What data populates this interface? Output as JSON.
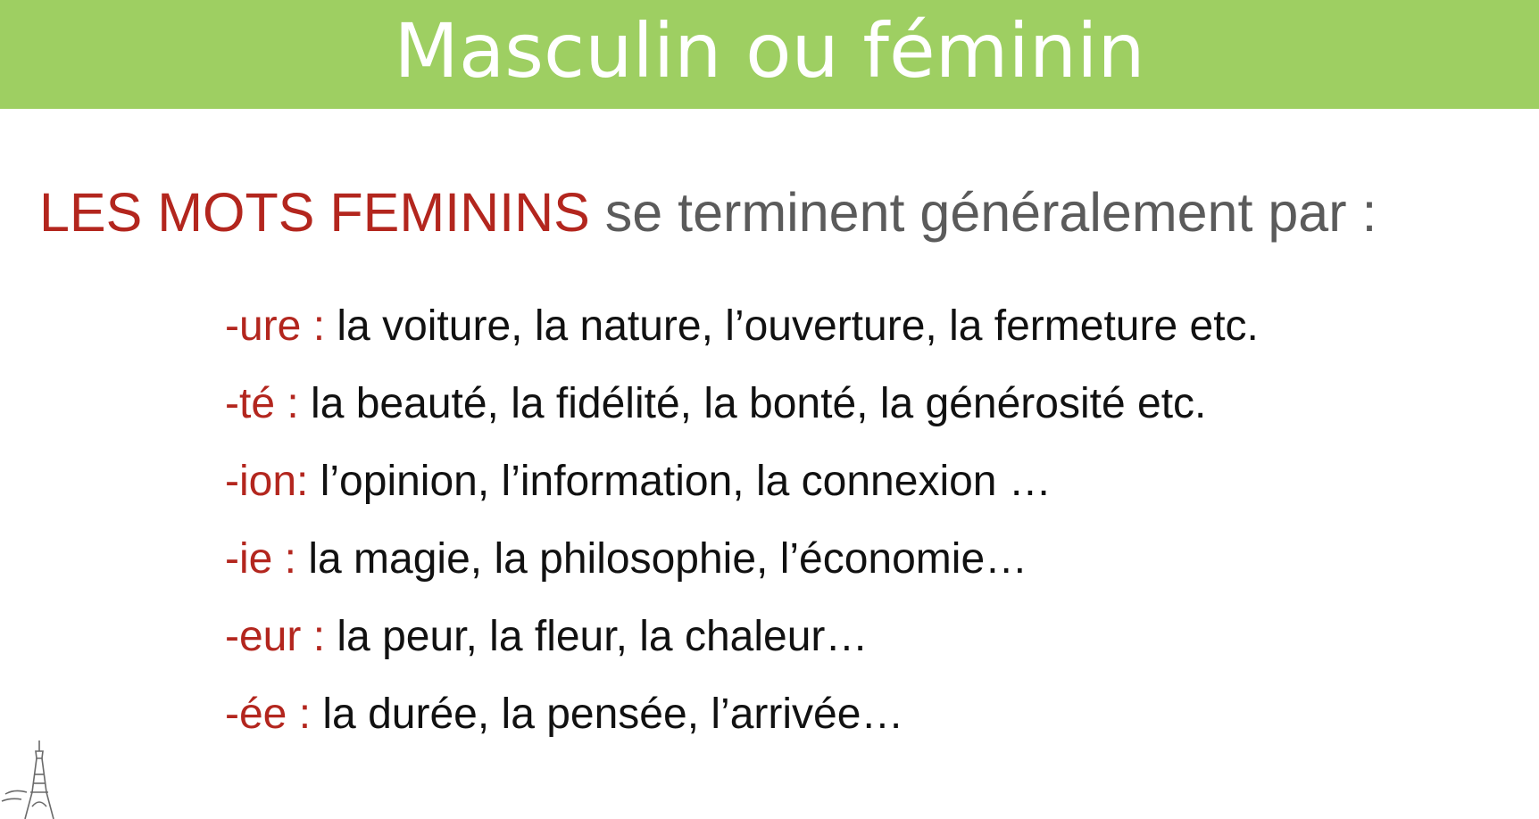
{
  "title": "Masculin ou féminin",
  "heading": {
    "highlight": "LES MOTS FEMININS",
    "rest": " se terminent généralement par :"
  },
  "colors": {
    "banner": "#9ecf62",
    "accent_red": "#b3261e"
  },
  "rows": [
    {
      "suffix": "-ure : ",
      "examples": "la voiture, la nature, l’ouverture, la fermeture etc."
    },
    {
      "suffix": "-té : ",
      "examples": "la beauté, la fidélité, la bonté, la générosité etc."
    },
    {
      "suffix": "-ion: ",
      "examples": " l’opinion, l’information, la connexion …"
    },
    {
      "suffix": "-ie : ",
      "examples": "la magie, la philosophie, l’économie…"
    },
    {
      "suffix": "-eur : ",
      "examples": "la peur, la fleur, la chaleur…"
    },
    {
      "suffix": "-ée : ",
      "examples": "la durée, la pensée, l’arrivée…"
    }
  ],
  "decoration": {
    "icon": "eiffel-tower-icon"
  }
}
